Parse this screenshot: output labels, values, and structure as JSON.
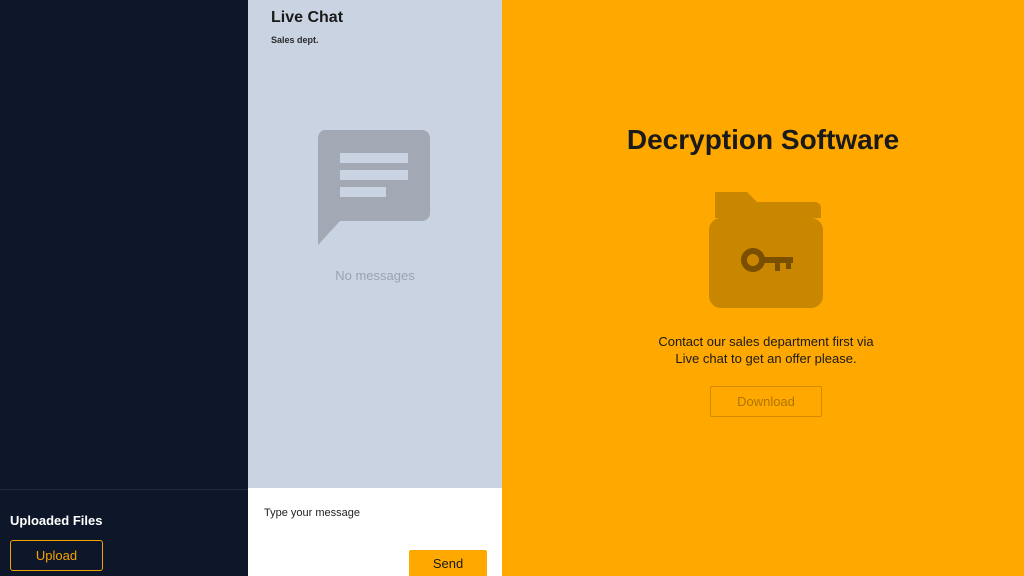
{
  "sidebar": {
    "uploaded_title": "Uploaded Files",
    "upload_label": "Upload"
  },
  "chat": {
    "title": "Live Chat",
    "subtitle": "Sales dept.",
    "empty_text": "No messages",
    "input_placeholder": "Type your message",
    "input_value": "",
    "send_label": "Send",
    "icon": "chat-bubble-icon"
  },
  "main": {
    "title": "Decryption Software",
    "icon": "key-folder-icon",
    "description_line1": "Contact our sales department first via",
    "description_line2": "Live chat to get an offer please.",
    "download_label": "Download"
  },
  "colors": {
    "sidebar_bg": "#0e172a",
    "chat_bg": "#c9d3e2",
    "accent": "#ffa800",
    "icon_gray": "#a2a9b5",
    "icon_dark_orange": "#c98600"
  }
}
